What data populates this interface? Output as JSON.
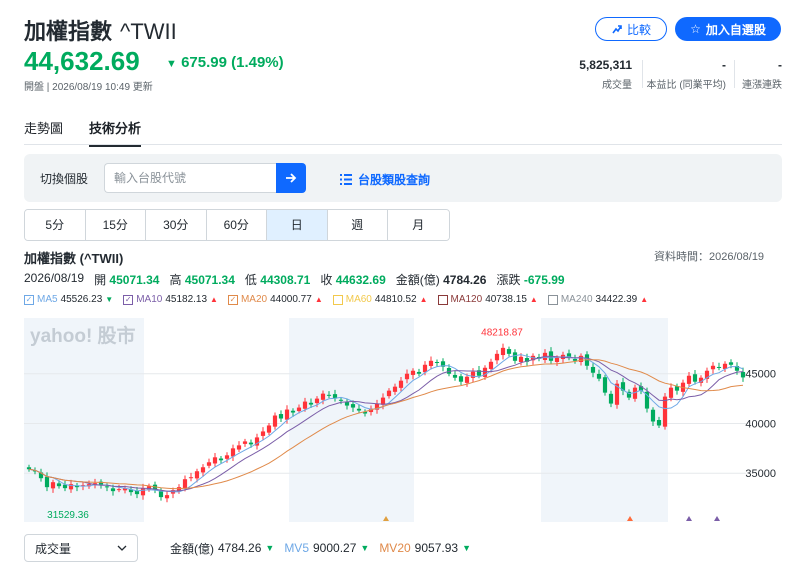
{
  "header": {
    "name": "加權指數",
    "symbol": "^TWII",
    "price": "44,632.69",
    "change_arrow": "▼",
    "change": "675.99 (1.49%)",
    "status": "開盤 | 2026/08/19 10:49 更新",
    "compare_label": "比較",
    "add_watch_label": "加入自選股"
  },
  "stats": [
    {
      "value": "5,825,311",
      "label": "成交量"
    },
    {
      "value": "-",
      "label": "本益比 (同業平均)"
    },
    {
      "value": "-",
      "label": "連漲連跌"
    }
  ],
  "tabs": [
    {
      "label": "走勢圖",
      "active": false
    },
    {
      "label": "技術分析",
      "active": true
    }
  ],
  "search": {
    "label": "切換個股",
    "placeholder": "輸入台股代號",
    "category_link": "台股類股查詢"
  },
  "periods": [
    {
      "label": "5分",
      "active": false
    },
    {
      "label": "15分",
      "active": false
    },
    {
      "label": "30分",
      "active": false
    },
    {
      "label": "60分",
      "active": false
    },
    {
      "label": "日",
      "active": true
    },
    {
      "label": "週",
      "active": false
    },
    {
      "label": "月",
      "active": false
    }
  ],
  "chart_header": {
    "title": "加權指數 (^TWII)",
    "data_time": "資料時間：2026/08/19",
    "date": "2026/08/19",
    "open_label": "開",
    "open": "45071.34",
    "high_label": "高",
    "high": "45071.34",
    "low_label": "低",
    "low": "44308.71",
    "close_label": "收",
    "close": "44632.69",
    "amount_label": "金額(億)",
    "amount": "4784.26",
    "change_label": "漲跌",
    "change": "-675.99"
  },
  "ma_legend": [
    {
      "name": "MA5",
      "value": "45526.23",
      "dir": "down",
      "color": "#6ea8e6",
      "checked": true
    },
    {
      "name": "MA10",
      "value": "45182.13",
      "dir": "up",
      "color": "#7b5ea8",
      "checked": true
    },
    {
      "name": "MA20",
      "value": "44000.77",
      "dir": "up",
      "color": "#e08a4a",
      "checked": true
    },
    {
      "name": "MA60",
      "value": "44810.52",
      "dir": "up",
      "color": "#f2c94c",
      "checked": false
    },
    {
      "name": "MA120",
      "value": "40738.15",
      "dir": "up",
      "color": "#8b3a3a",
      "checked": false
    },
    {
      "name": "MA240",
      "value": "34422.39",
      "dir": "up",
      "color": "#8a9299",
      "checked": false
    }
  ],
  "chart_data": {
    "type": "candlestick",
    "y_ticks": [
      35000,
      40000,
      45000
    ],
    "ylim": [
      30500,
      50200
    ],
    "annotations": {
      "max": "48218.87",
      "min": "31529.36"
    },
    "watermark": "yahoo! 股市",
    "closes": [
      35400,
      35200,
      34500,
      33600,
      34100,
      33700,
      33500,
      33900,
      33600,
      33800,
      33900,
      34000,
      33800,
      33600,
      33200,
      33400,
      33500,
      33100,
      32900,
      33500,
      33700,
      33300,
      32600,
      32800,
      33300,
      33600,
      34400,
      34600,
      35200,
      35600,
      36100,
      36600,
      36300,
      36800,
      37500,
      37800,
      38200,
      37900,
      38600,
      39200,
      39800,
      40800,
      40500,
      41400,
      41100,
      41600,
      42200,
      41900,
      42500,
      43000,
      42800,
      42500,
      42300,
      41800,
      41600,
      41300,
      41000,
      41500,
      42000,
      42600,
      43300,
      43700,
      44300,
      45000,
      45300,
      45000,
      45900,
      46300,
      46100,
      45700,
      45000,
      44600,
      44200,
      44700,
      45200,
      44800,
      45600,
      46200,
      47000,
      47600,
      47000,
      46300,
      46700,
      46200,
      46800,
      46500,
      47100,
      46300,
      46600,
      46900,
      46600,
      46300,
      46800,
      45800,
      45100,
      44500,
      43100,
      42000,
      44000,
      43300,
      42600,
      43600,
      43300,
      41500,
      40200,
      39800,
      42700,
      43600,
      43300,
      44100,
      44800,
      44200,
      44600,
      45300,
      45800,
      45600,
      46000,
      45900,
      45300,
      44630
    ]
  },
  "volume_bar": {
    "select_label": "成交量",
    "amount_label": "金額(億)",
    "amount": "4784.26",
    "mv5_label": "MV5",
    "mv5": "9000.27",
    "mv20_label": "MV20",
    "mv20": "9057.93"
  }
}
